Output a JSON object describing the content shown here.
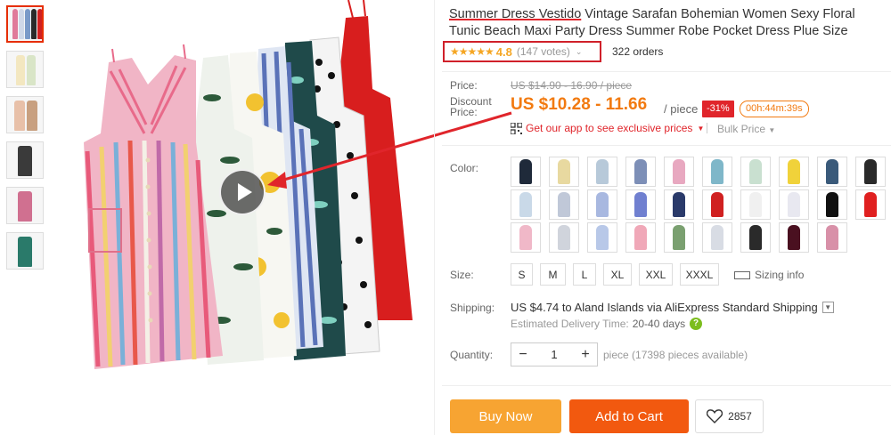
{
  "product": {
    "title_highlight": "Summer Dress Vestido",
    "title_rest": " Vintage Sarafan Bohemian Women Sexy Floral Tunic Beach Maxi Party Dress Summer Robe Pocket Dress Plue Size"
  },
  "rating": {
    "stars": "★★★★★",
    "value": "4.8",
    "votes": "(147 votes)",
    "orders": "322 orders",
    "box_color": "#d0202a"
  },
  "price": {
    "price_label": "Price:",
    "old_price": "US $14.90 - 16.90 / piece",
    "discount_label_1": "Discount",
    "discount_label_2": "Price:",
    "discount_price": "US $10.28 - 11.66",
    "per_piece": "/ piece",
    "off_badge": "-31%",
    "timer": "00h:44m:39s",
    "app_prices": "Get our app to see exclusive prices",
    "bulk_price": "Bulk Price"
  },
  "color": {
    "label": "Color:",
    "swatches": [
      "#1f2a3a",
      "#e8d9a0",
      "#b7c9d9",
      "#7d8fb7",
      "#e8a8c0",
      "#7fb7c9",
      "#c9e0d0",
      "#f0d23a",
      "#3a5a7a",
      "#2a2a2a",
      "#c9d9e8",
      "#c0c8d8",
      "#a8b8e0",
      "#7080d0",
      "#2a3a6a",
      "#d02020",
      "#f0f0f0",
      "#e8e8f0",
      "#111111",
      "#e02020",
      "#f0b8c8",
      "#d0d4dc",
      "#b8c8e8",
      "#f0a8b8",
      "#7aa070",
      "#d8dce4",
      "#2a2a2a",
      "#4a1020",
      "#d890a8"
    ]
  },
  "size": {
    "label": "Size:",
    "options": [
      "S",
      "M",
      "L",
      "XL",
      "XXL",
      "XXXL"
    ],
    "sizing_info": "Sizing info"
  },
  "shipping": {
    "label": "Shipping:",
    "main": "US $4.74 to Aland Islands via AliExpress Standard Shipping",
    "delivery_label": "Estimated Delivery Time:",
    "delivery_days": "20-40 days"
  },
  "quantity": {
    "label": "Quantity:",
    "value": "1",
    "available": "piece (17398 pieces available)"
  },
  "actions": {
    "buy_now": "Buy Now",
    "add_to_cart": "Add to Cart",
    "wishlist_count": "2857"
  },
  "colors": {
    "accent_red": "#e0252b",
    "price_orange": "#f27a10",
    "buy_orange": "#f7a432",
    "cart_orange": "#f2590f"
  }
}
